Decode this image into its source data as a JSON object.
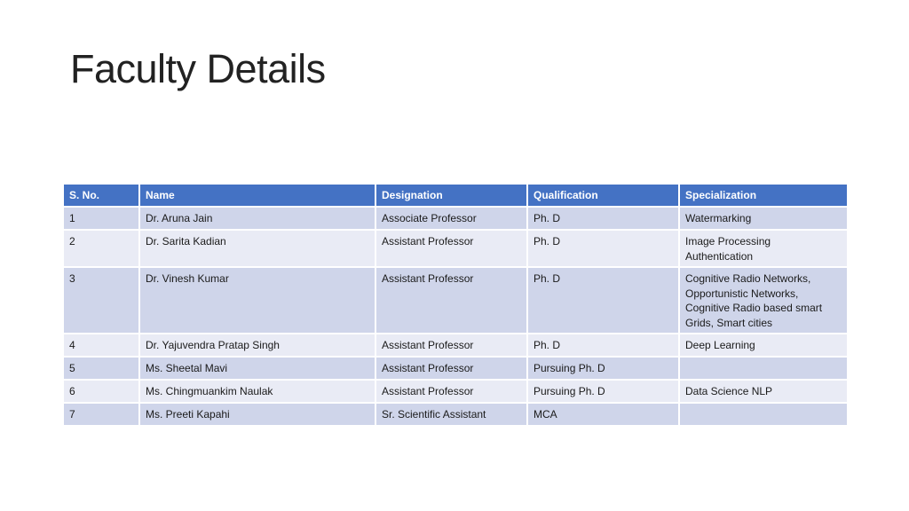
{
  "slide": {
    "title": "Faculty Details"
  },
  "table": {
    "headers": {
      "sno": "S. No.",
      "name": "Name",
      "designation": "Designation",
      "qualification": "Qualification",
      "specialization": "Specialization"
    },
    "rows": [
      {
        "sno": "1",
        "name": "Dr. Aruna Jain",
        "designation": "Associate Professor",
        "qualification": "Ph. D",
        "specialization": [
          "Watermarking"
        ]
      },
      {
        "sno": "2",
        "name": "Dr. Sarita Kadian",
        "designation": "Assistant Professor",
        "qualification": "Ph. D",
        "specialization": [
          "Image Processing",
          "Authentication"
        ]
      },
      {
        "sno": "3",
        "name": "Dr. Vinesh Kumar",
        "designation": "Assistant Professor",
        "qualification": "Ph. D",
        "specialization": [
          "Cognitive Radio Networks,",
          "Opportunistic Networks,",
          "Cognitive Radio based smart",
          "Grids, Smart cities"
        ]
      },
      {
        "sno": "4",
        "name": "Dr. Yajuvendra Pratap Singh",
        "designation": "Assistant Professor",
        "qualification": "Ph. D",
        "specialization": [
          "Deep Learning"
        ]
      },
      {
        "sno": "5",
        "name": "Ms. Sheetal Mavi",
        "designation": "Assistant Professor",
        "qualification": "Pursuing Ph. D",
        "specialization": []
      },
      {
        "sno": "6",
        "name": "Ms. Chingmuankim Naulak",
        "designation": "Assistant Professor",
        "qualification": "Pursuing Ph. D",
        "specialization": [
          "Data Science NLP"
        ]
      },
      {
        "sno": "7",
        "name": "Ms. Preeti Kapahi",
        "designation": "Sr. Scientific Assistant",
        "qualification": "MCA",
        "specialization": []
      }
    ]
  }
}
